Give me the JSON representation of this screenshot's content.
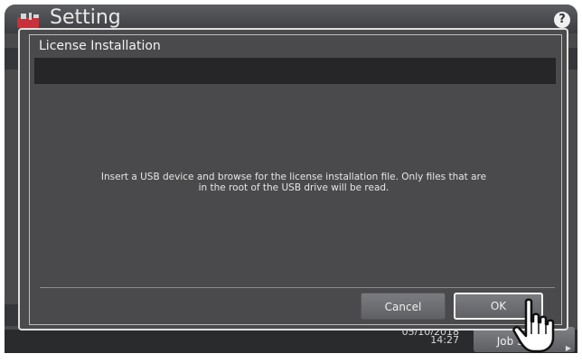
{
  "app": {
    "title": "Setting",
    "help_label": "?"
  },
  "dialog": {
    "title": "License Installation",
    "message_line1": "Insert a USB device and browse for the license installation file. Only files that are",
    "message_line2": "in the root of the USB drive will be read.",
    "cancel_label": "Cancel",
    "ok_label": "OK"
  },
  "status": {
    "date": "05/10/2018",
    "time": "14:27",
    "job_status_label": "Job Status"
  },
  "colors": {
    "panel": "#4a4a4c",
    "dark_strip": "#262628",
    "accent_text": "#f2f2f2"
  },
  "icons": {
    "app": "setting-toolbox-icon",
    "cursor": "pointing-hand-icon"
  }
}
